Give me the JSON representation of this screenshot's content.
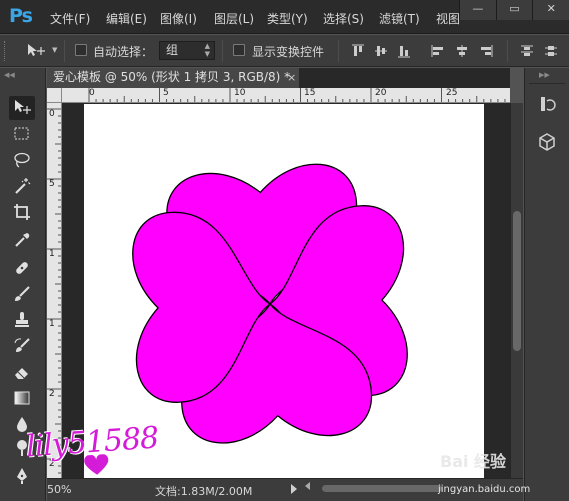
{
  "app": {
    "logo": "Ps",
    "menu": [
      "文件(F)",
      "编辑(E)",
      "图像(I)",
      "图层(L)",
      "类型(Y)",
      "选择(S)",
      "滤镜(T)",
      "视图"
    ],
    "window_controls": [
      "—",
      "▭",
      "✕"
    ]
  },
  "options_bar": {
    "auto_select_label": "自动选择：",
    "auto_select_value": "组",
    "show_transform_label": "显示变换控件"
  },
  "document_tab": {
    "title": "爱心模板 @ 50% (形状 1 拷贝 3, RGB/8) *",
    "close": "×"
  },
  "rulers": {
    "top_labels": [
      "0",
      "5",
      "10",
      "15",
      "20",
      "25"
    ],
    "left_labels": [
      "0",
      "5",
      "1",
      "1",
      "2",
      "2"
    ]
  },
  "status_bar": {
    "zoom": "50%",
    "doc_info": "文档:1.83M/2.00M"
  },
  "tools": [
    "move-tool",
    "marquee-tool",
    "lasso-tool",
    "magic-wand-tool",
    "crop-tool",
    "eyedropper-tool",
    "healing-brush-tool",
    "brush-tool",
    "clone-stamp-tool",
    "history-brush-tool",
    "eraser-tool",
    "gradient-tool",
    "blur-tool",
    "dodge-tool",
    "pen-tool"
  ],
  "artwork": {
    "fill_color": "#ff00ff",
    "stroke_color": "#000000"
  },
  "watermarks": {
    "signature": "lily51588",
    "baidu": "Bai 经验",
    "baidu_url": "jingyan.baidu.com"
  },
  "colors": {
    "menubar_bg": "#2b2b2b",
    "panel_bg": "#3c3c3c",
    "canvas_bg": "#282828",
    "accent": "#3aa6e8"
  }
}
